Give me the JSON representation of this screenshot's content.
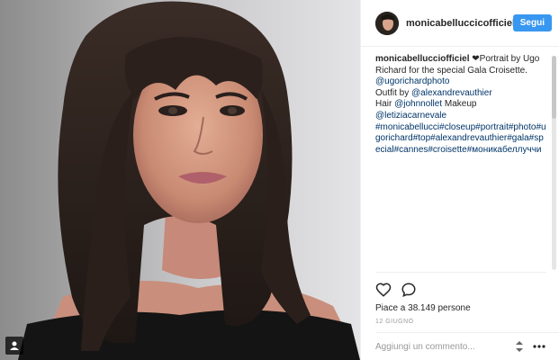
{
  "post": {
    "username": "monicabelluccicofficiel",
    "follow_label": "Segui",
    "caption": {
      "author": "monicabellucciofficiel",
      "heart": "❤",
      "line1": "Portrait by Ugo Richard for the special Gala Croisette.",
      "mention_photographer": "@ugorichardphoto",
      "outfit_prefix": "Outfit by ",
      "mention_outfit": "@alexandrevauthier",
      "hair_prefix": "Hair ",
      "mention_hair": "@johnnollet",
      "makeup_text": " Makeup",
      "mention_makeup": "@letiziacarnevale",
      "hashtags": "#monicabellucci#closeup#portrait#photo#ugorichard#top#alexandrevauthier#gala#special#cannes#croisette#моникабеллуччи"
    },
    "likes_text": "Piace a 38.149 persone",
    "date": "12 GIUGNO",
    "comment_placeholder": "Aggiungi un commento...",
    "icons": [
      "heart-icon",
      "comment-icon",
      "more-options-icon",
      "user-tag-icon"
    ],
    "colors": {
      "accent": "#3897f0",
      "link": "#003569",
      "muted": "#999999"
    }
  }
}
